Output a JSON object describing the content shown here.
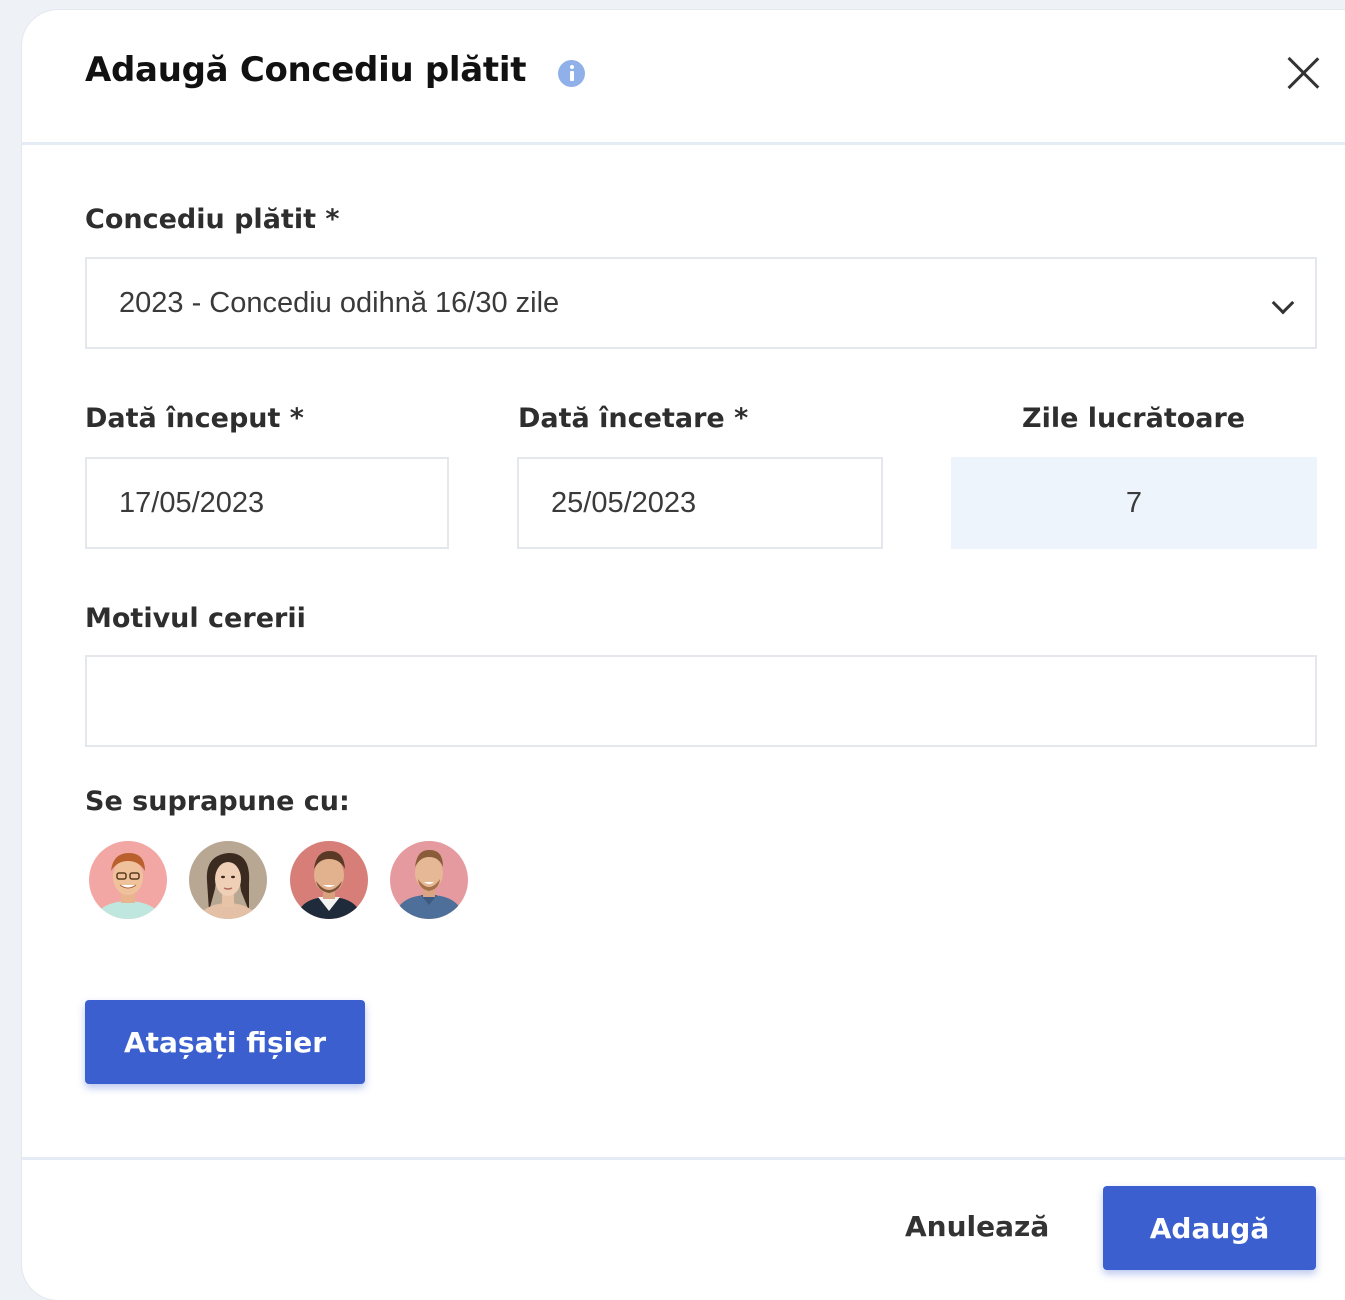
{
  "dialog": {
    "title": "Adaugă Concediu plătit"
  },
  "form": {
    "leave_type": {
      "label": "Concediu plătit *",
      "value": "2023 - Concediu odihnă 16/30 zile"
    },
    "start_date": {
      "label": "Dată început *",
      "value": "17/05/2023"
    },
    "end_date": {
      "label": "Dată încetare *",
      "value": "25/05/2023"
    },
    "working_days": {
      "label": "Zile lucrătoare",
      "value": "7"
    },
    "reason": {
      "label": "Motivul cererii",
      "value": ""
    },
    "overlaps": {
      "label": "Se suprapune cu:"
    },
    "attach_label": "Atașați fișier"
  },
  "footer": {
    "cancel_label": "Anulează",
    "submit_label": "Adaugă"
  },
  "colors": {
    "primary": "#3b5fce",
    "info_icon": "#8fb0e8",
    "readonly_bg": "#eef4fc"
  }
}
